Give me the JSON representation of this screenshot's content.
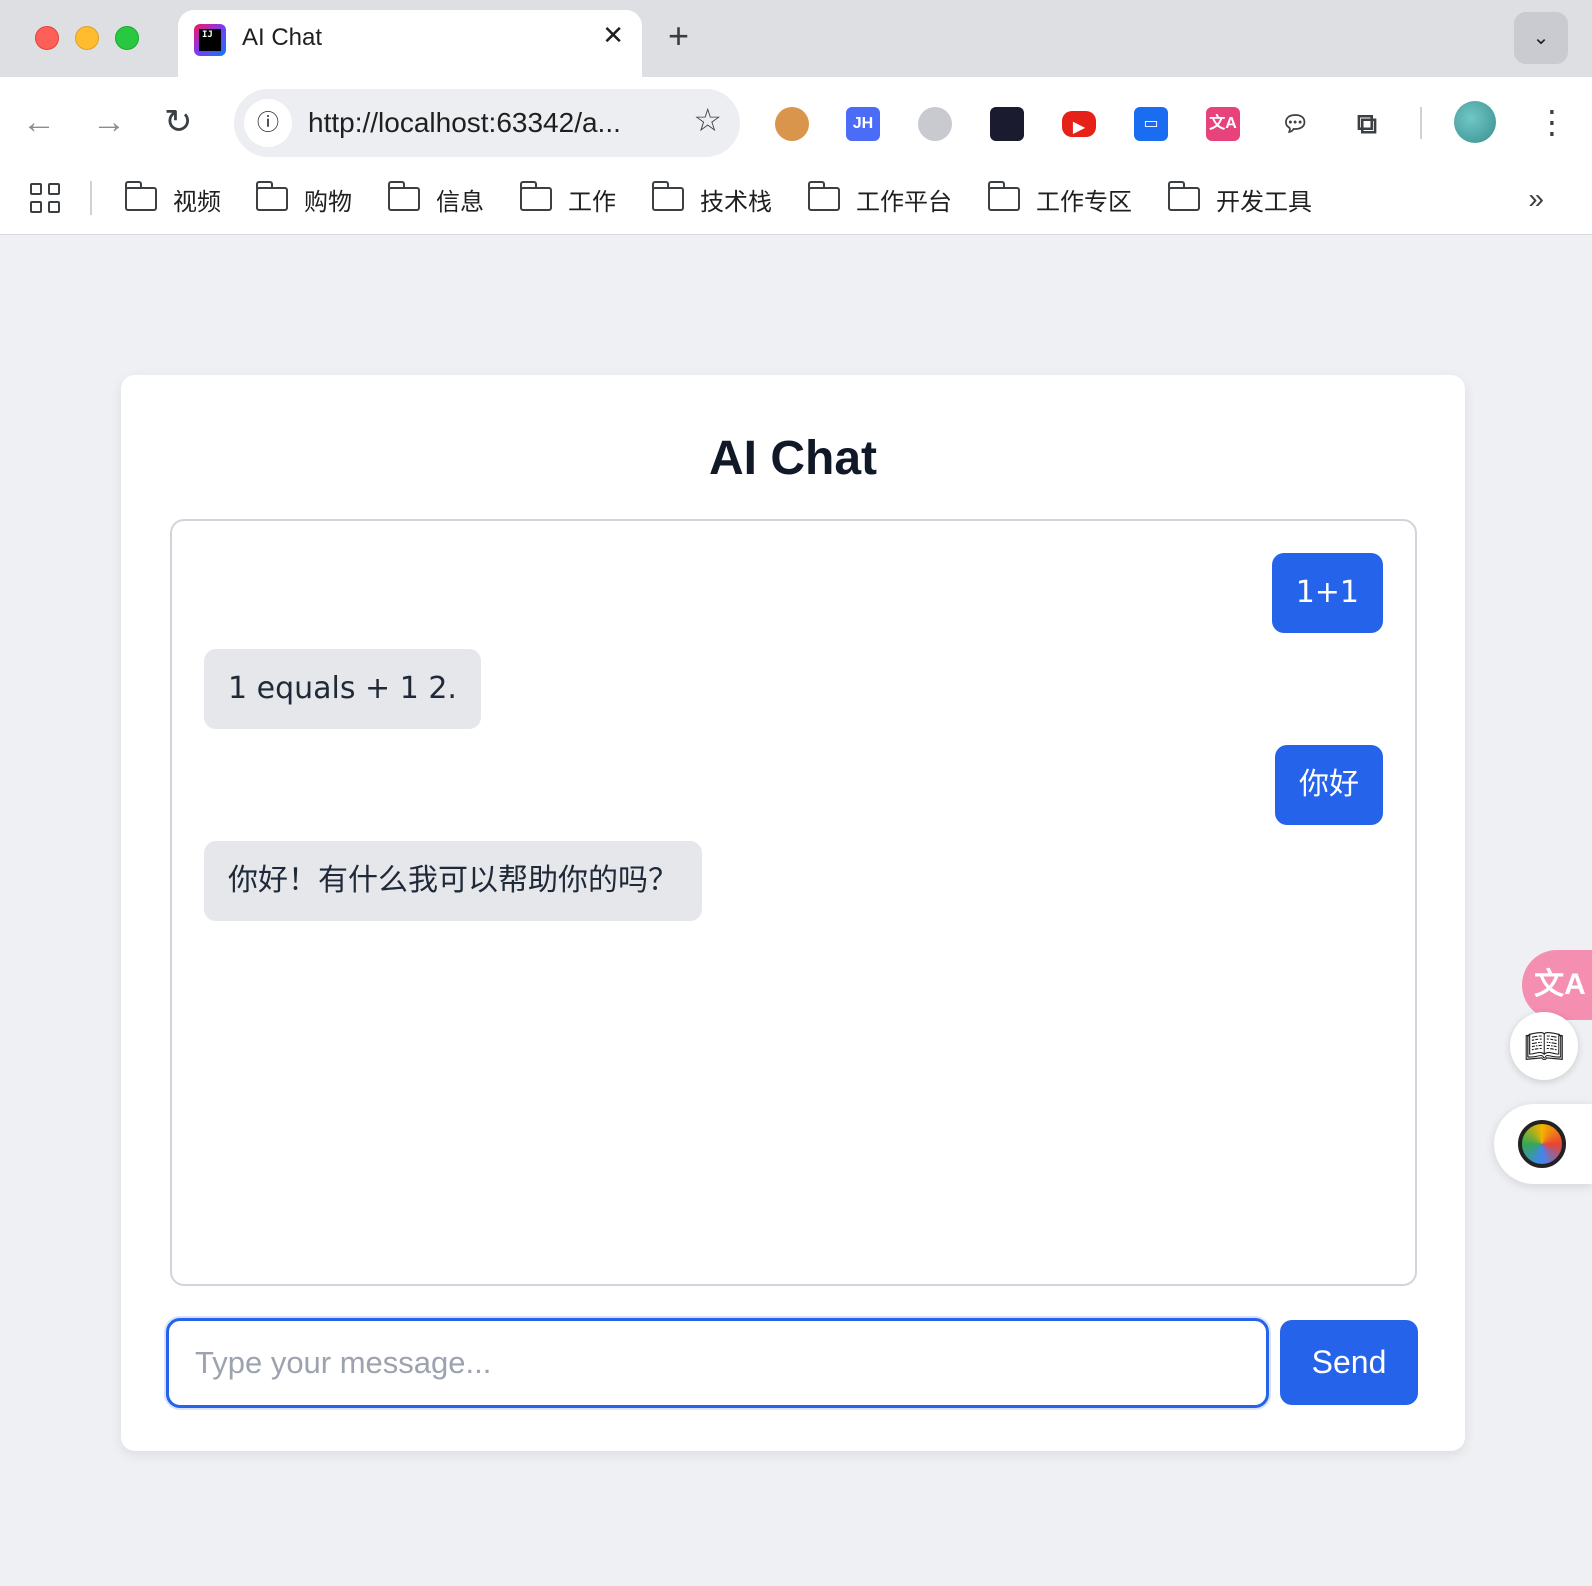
{
  "browser": {
    "tab_title": "AI Chat",
    "tab_close": "✕",
    "new_tab": "+",
    "url": "http://localhost:63342/a...",
    "bookmarks": [
      "视频",
      "购物",
      "信息",
      "工作",
      "技术栈",
      "工作平台",
      "工作专区",
      "开发工具"
    ],
    "extensions": [
      "cookie-icon",
      "jh-icon",
      "bird-icon",
      "brain-icon",
      "youtube-icon",
      "screen-icon",
      "translate-icon",
      "chat-bubble-icon",
      "puzzle-icon"
    ],
    "ext_jh_label": "JH"
  },
  "page": {
    "title": "AI Chat",
    "messages": [
      {
        "role": "user",
        "text": "1+1"
      },
      {
        "role": "ai",
        "text": "1 equals + 1 2."
      },
      {
        "role": "user",
        "text": "你好"
      },
      {
        "role": "ai",
        "text": "你好！有什么我可以帮助你的吗？"
      }
    ],
    "input_placeholder": "Type your message...",
    "send_label": "Send"
  },
  "colors": {
    "accent": "#2563eb",
    "ai_bubble": "#e5e7eb",
    "page_bg": "#eef0f4"
  }
}
